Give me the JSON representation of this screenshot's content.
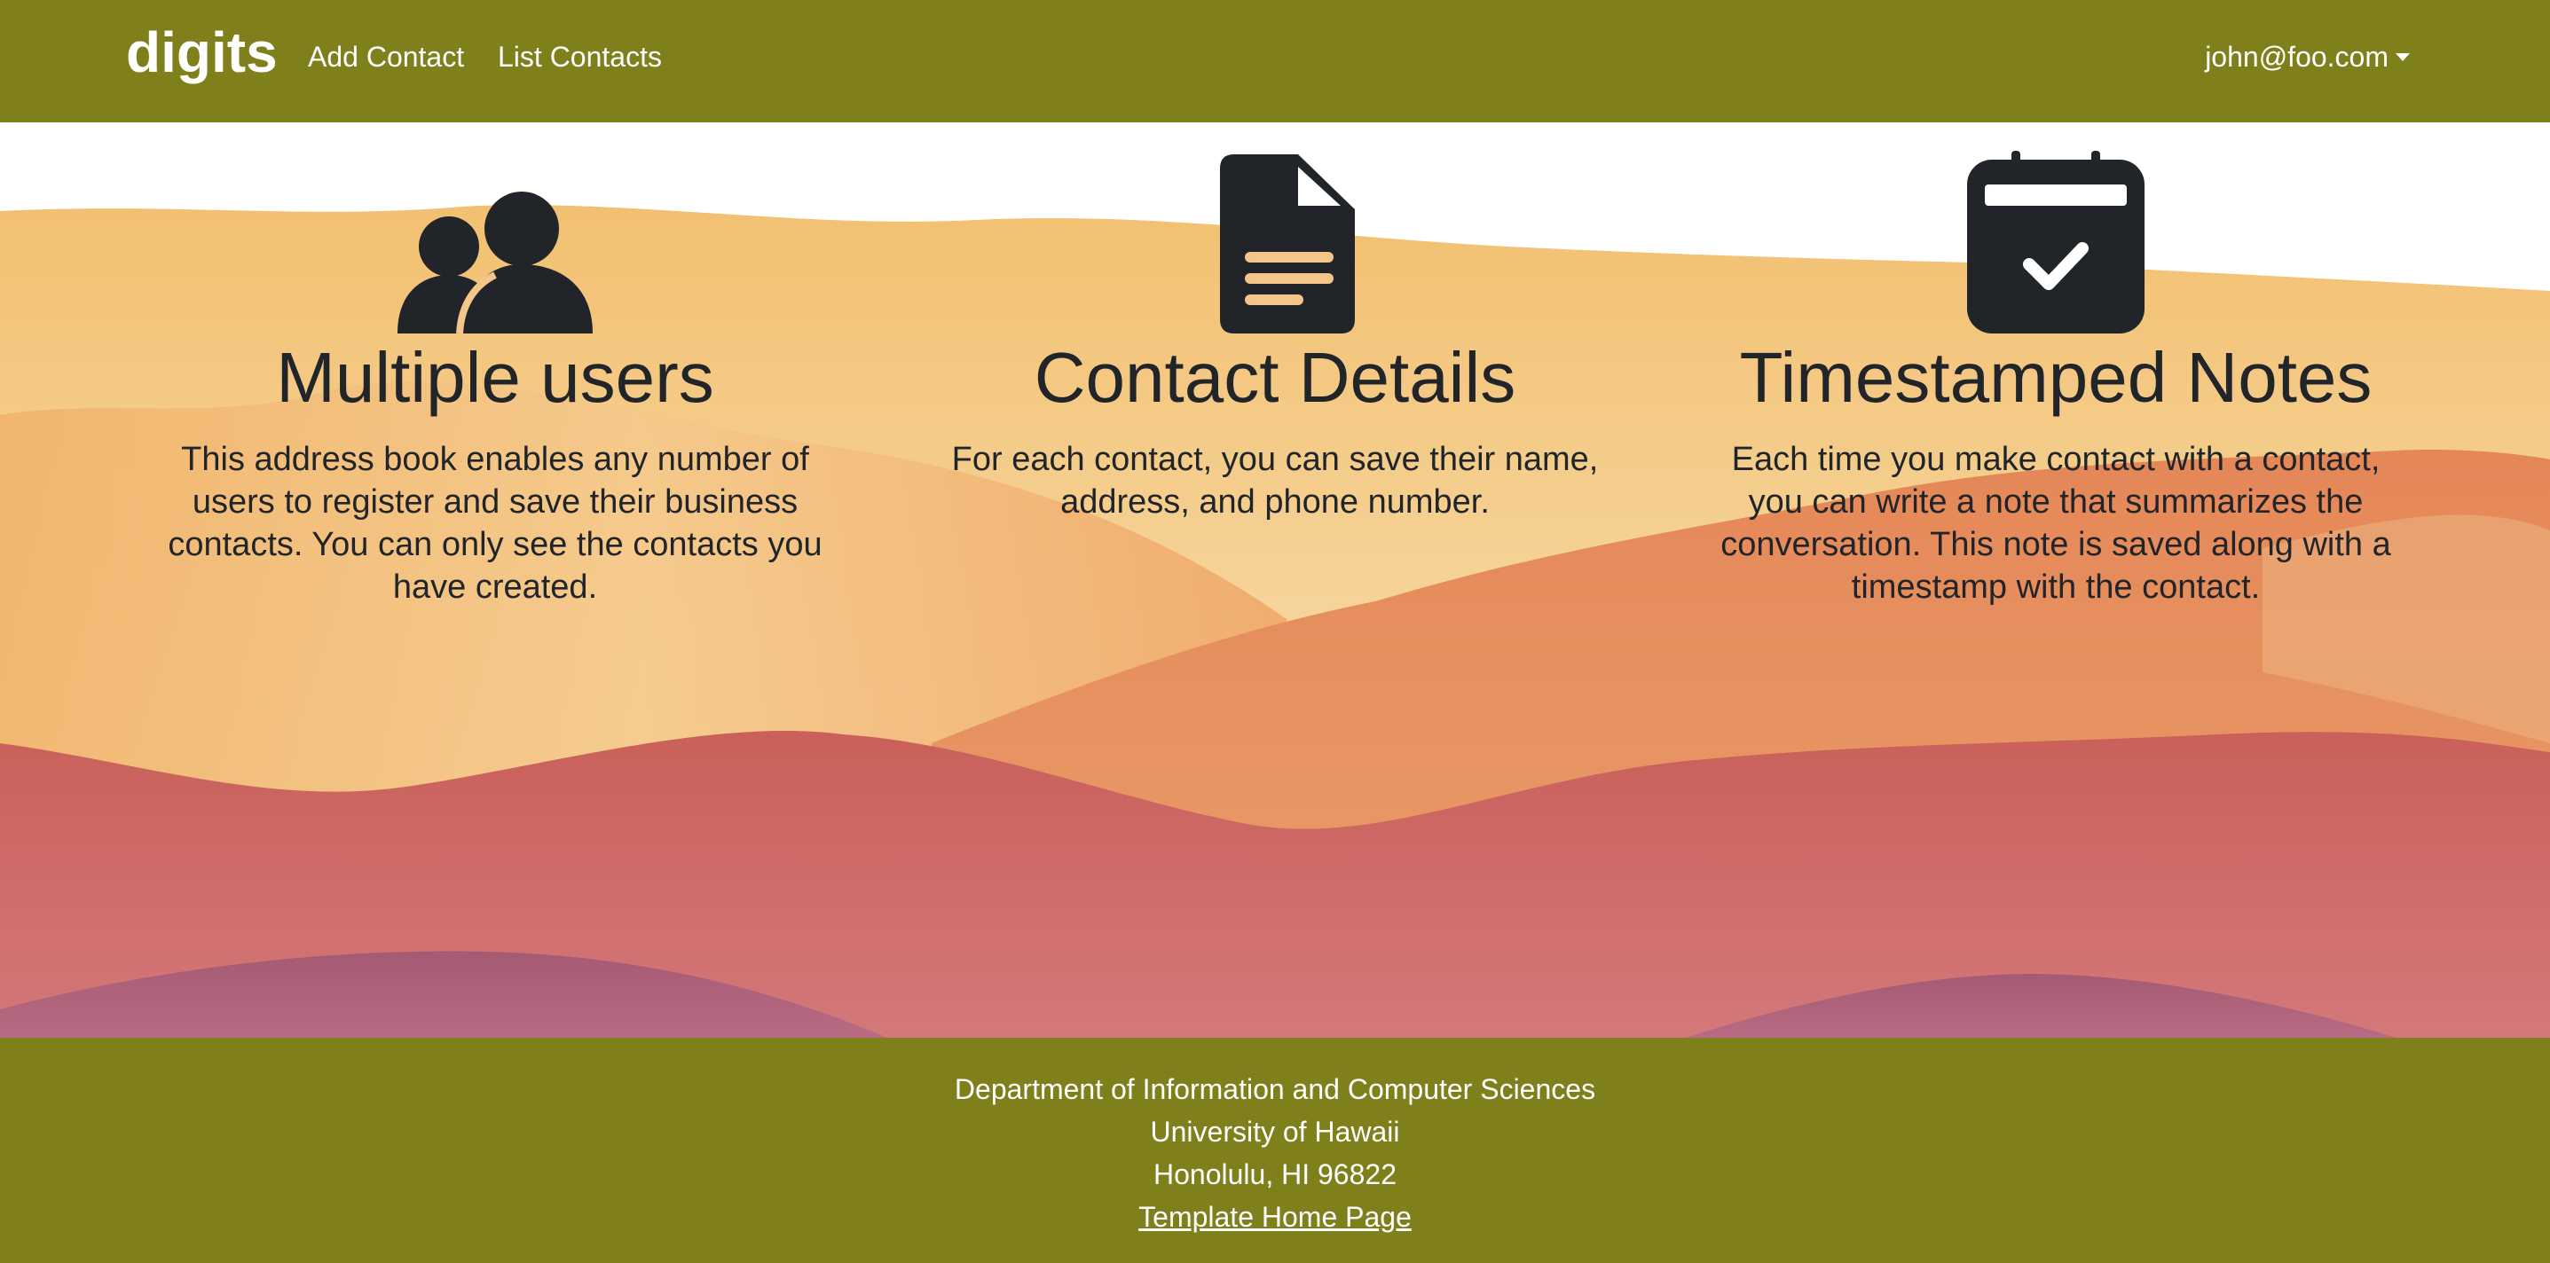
{
  "navbar": {
    "brand": "digits",
    "links": [
      "Add Contact",
      "List Contacts"
    ],
    "user": "john@foo.com"
  },
  "features": [
    {
      "icon": "users-icon",
      "title": "Multiple users",
      "text": "This address book enables any number of users to register and save their business contacts. You can only see the contacts you have created."
    },
    {
      "icon": "file-lines-icon",
      "title": "Contact Details",
      "text": "For each contact, you can save their name, address, and phone number."
    },
    {
      "icon": "calendar-check-icon",
      "title": "Timestamped Notes",
      "text": "Each time you make contact with a contact, you can write a note that summarizes the conversation. This note is saved along with a timestamp with the contact."
    }
  ],
  "footer": {
    "lines": [
      "Department of Information and Computer Sciences",
      "University of Hawaii",
      "Honolulu, HI 96822"
    ],
    "link": "Template Home Page"
  },
  "colors": {
    "nav_bg": "#7f7f1c",
    "text_dark": "#212529"
  }
}
